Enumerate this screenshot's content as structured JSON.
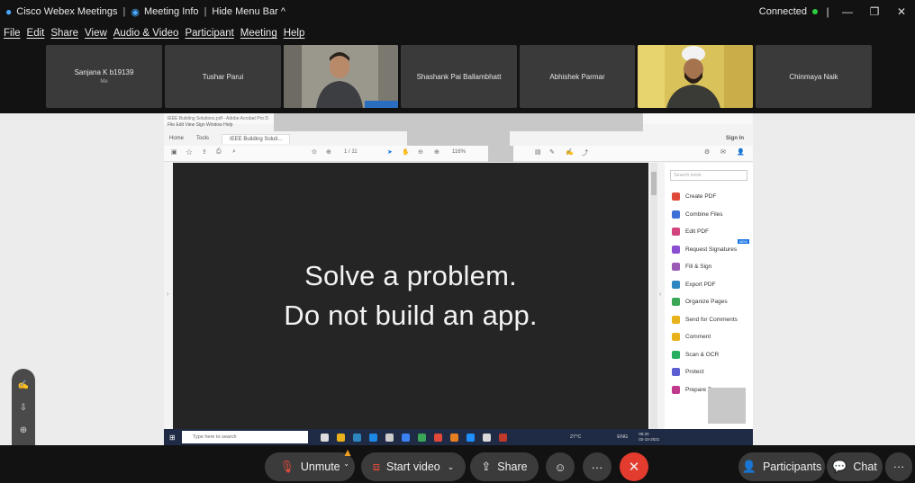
{
  "titlebar": {
    "app_name": "Cisco Webex Meetings",
    "meeting_info": "Meeting Info",
    "hide_menu": "Hide Menu Bar ^",
    "status": "Connected"
  },
  "menu": [
    "File",
    "Edit",
    "Share",
    "View",
    "Audio & Video",
    "Participant",
    "Meeting",
    "Help"
  ],
  "participants": [
    {
      "name": "Sanjana K b19139",
      "sub": "Me",
      "video": false
    },
    {
      "name": "Tushar Parui",
      "sub": "",
      "video": false
    },
    {
      "name": "",
      "sub": "",
      "video": true
    },
    {
      "name": "Shashank Pai Ballambhatt",
      "sub": "",
      "video": false
    },
    {
      "name": "Abhishek Parmar",
      "sub": "",
      "video": false
    },
    {
      "name": "",
      "sub": "",
      "video": true
    },
    {
      "name": "Chinmaya Naik",
      "sub": "",
      "video": false
    }
  ],
  "shared": {
    "acrobat_title": "IEEE Building Solutions.pdf - Adobe Acrobat Pro D",
    "acrobat_menu": "File  Edit  View  Sign  Window  Help",
    "tab_home": "Home",
    "tab_tools": "Tools",
    "tab_doc": "IEEE Building Soluti...",
    "sign_in": "Sign In",
    "page_of": "1 / 11",
    "zoom": "116%",
    "slide_line1": "Solve a problem.",
    "slide_line2": "Do not build an app.",
    "search_tools": "Search tools",
    "tools": [
      {
        "label": "Create PDF",
        "color": "#e0493a"
      },
      {
        "label": "Combine Files",
        "color": "#3d6fd8"
      },
      {
        "label": "Edit PDF",
        "color": "#d2447d"
      },
      {
        "label": "Request Signatures",
        "color": "#8a4fd1"
      },
      {
        "label": "Fill & Sign",
        "color": "#9b59b6"
      },
      {
        "label": "Export PDF",
        "color": "#2e86c1"
      },
      {
        "label": "Organize Pages",
        "color": "#3aa656"
      },
      {
        "label": "Send for Comments",
        "color": "#e8b21c"
      },
      {
        "label": "Comment",
        "color": "#e8b21c"
      },
      {
        "label": "Scan & OCR",
        "color": "#27ae60"
      },
      {
        "label": "Protect",
        "color": "#5b5fd1"
      },
      {
        "label": "Prepare Form",
        "color": "#c0398a"
      }
    ],
    "new_badge": "NEW",
    "taskbar_search": "Type here to search",
    "taskbar_weather": "27°C",
    "taskbar_lang": "ENG",
    "taskbar_time": "09:20",
    "taskbar_date": "02-10-2021"
  },
  "controls": {
    "unmute": "Unmute",
    "start_video": "Start video",
    "share": "Share",
    "participants": "Participants",
    "chat": "Chat"
  }
}
